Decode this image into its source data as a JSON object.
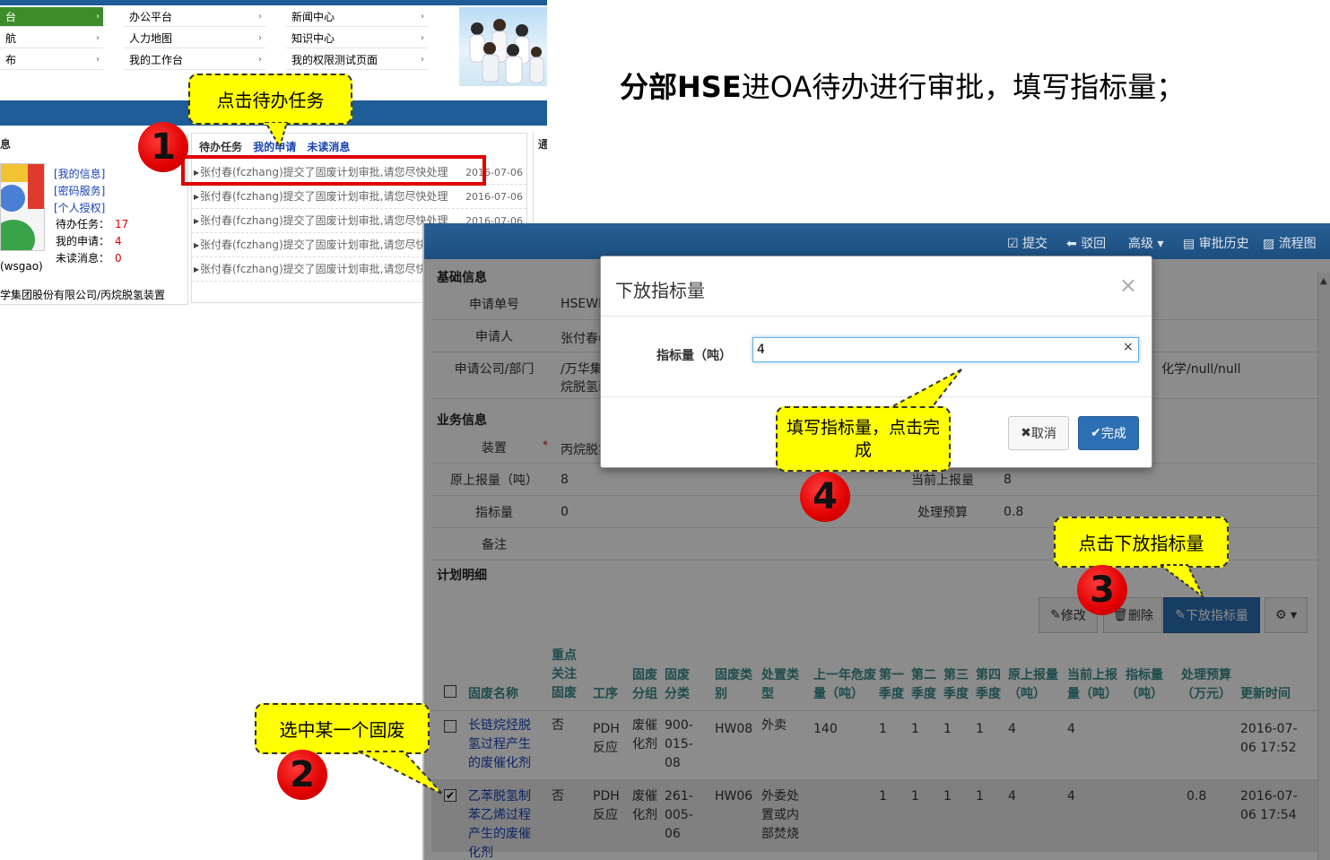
{
  "portal": {
    "menu": [
      {
        "label": "台",
        "arrow": "›",
        "active": true
      },
      {
        "label": "办公平台",
        "arrow": "›"
      },
      {
        "label": "新闻中心",
        "arrow": "›"
      },
      {
        "label": "航",
        "arrow": "›"
      },
      {
        "label": "人力地图",
        "arrow": "›"
      },
      {
        "label": "知识中心",
        "arrow": "›"
      },
      {
        "label": "布",
        "arrow": "›"
      },
      {
        "label": "我的工作台",
        "arrow": "›"
      },
      {
        "label": "我的权限测试页面",
        "arrow": "›"
      }
    ],
    "user_panel": {
      "heading": "息",
      "links": [
        "[我的信息]",
        "[密码服务]",
        "[个人授权]"
      ],
      "stats": [
        {
          "label": "待办任务：",
          "value": "17"
        },
        {
          "label": "我的申请：",
          "value": "4"
        },
        {
          "label": "未读消息：",
          "value": "0"
        }
      ],
      "username": "(wsgao)",
      "company": "学集团股份有限公司/丙烷脱氢装置"
    },
    "tabs": {
      "todo": "待办任务",
      "my_apply": "我的申请",
      "unread": "未读消息"
    },
    "todos": [
      {
        "text": "张付春(fczhang)提交了固废计划审批,请您尽快处理",
        "date": "2016-07-06"
      },
      {
        "text": "张付春(fczhang)提交了固废计划审批,请您尽快处理",
        "date": "2016-07-06"
      },
      {
        "text": "张付春(fczhang)提交了固废计划审批,请您尽快处理",
        "date": "2016-07-06"
      },
      {
        "text": "张付春(fczhang)提交了固废计划审批,请您尽快处理",
        "date": ""
      },
      {
        "text": "张付春(fczhang)提交了固废计划审批,请您尽快处理",
        "date": ""
      }
    ],
    "right_stub": "通"
  },
  "headline": {
    "bold": "分部HSE",
    "rest": "进OA待办进行审批，填写指标量；"
  },
  "callouts": {
    "c1": "点击待办任务",
    "c2": "选中某一个固废",
    "c3": "点击下放指标量",
    "c4": "填写指标量，点击完成"
  },
  "steps": {
    "s1": "1",
    "s2": "2",
    "s3": "3",
    "s4": "4"
  },
  "form": {
    "toolbar": {
      "submit": "提交",
      "reject": "驳回",
      "advanced": "高级",
      "history": "审批历史",
      "flow": "流程图"
    },
    "sec_basic": "基础信息",
    "basic": {
      "no_label": "申请单号",
      "no_value": "HSEWP",
      "applicant_label": "申请人",
      "applicant_value": "张付春(",
      "company_label": "申请公司/部门",
      "company_value": "/万华集",
      "company_value2": "烷脱氢装",
      "company_tail": "化学/null/null"
    },
    "sec_business": "业务信息",
    "business": {
      "device_label": "装置",
      "device_value": "丙烷脱氢",
      "orig_label": "原上报量（吨）",
      "orig_value": "8",
      "cur_label": "当前上报量",
      "cur_value": "8",
      "target_label": "指标量",
      "target_value": "0",
      "budget_label": "处理预算",
      "budget_value": "0.8",
      "remark_label": "备注"
    },
    "sec_plan": "计划明细",
    "plan_buttons": {
      "edit": "修改",
      "delete": "删除",
      "assign": "下放指标量",
      "gear": "⚙ ▾"
    },
    "columns": [
      "固废名称",
      "重点关注固废",
      "工序",
      "固废分组",
      "固废分类",
      "固废类别",
      "处置类型",
      "上一年危废量（吨）",
      "第一季度",
      "第二季度",
      "第三季度",
      "第四季度",
      "原上报量（吨）",
      "当前上报量（吨）",
      "指标量（吨）",
      "处理预算（万元）",
      "更新时间"
    ],
    "rows": [
      {
        "checked": false,
        "name": "长链烷烃脱氢过程产生的废催化剂",
        "key": "否",
        "process": "PDH反应",
        "group": "废催化剂",
        "cls": "900-015-08",
        "cat": "HW08",
        "disposal": "外卖",
        "last_year": "140",
        "q1": "1",
        "q2": "1",
        "q3": "1",
        "q4": "1",
        "orig": "4",
        "cur": "4",
        "target": "",
        "budget": "",
        "updated": "2016-07-06 17:52"
      },
      {
        "checked": true,
        "name": "乙苯脱氢制苯乙烯过程产生的废催化剂",
        "key": "否",
        "process": "PDH反应",
        "group": "废催化剂",
        "cls": "261-005-06",
        "cat": "HW06",
        "disposal": "外委处置或内部焚烧",
        "last_year": "",
        "q1": "1",
        "q2": "1",
        "q3": "1",
        "q4": "1",
        "orig": "4",
        "cur": "4",
        "target": "",
        "budget": "0.8",
        "updated": "2016-07-06 17:54"
      }
    ]
  },
  "modal": {
    "title": "下放指标量",
    "close": "×",
    "field_label": "指标量（吨）",
    "field_value": "4",
    "clear": "×",
    "cancel": "取消",
    "done": "完成"
  },
  "colors": {
    "navy": "#1f5d98",
    "callout": "#ffff00",
    "step_red": "#e00000",
    "primary_btn": "#2c6fb4"
  }
}
